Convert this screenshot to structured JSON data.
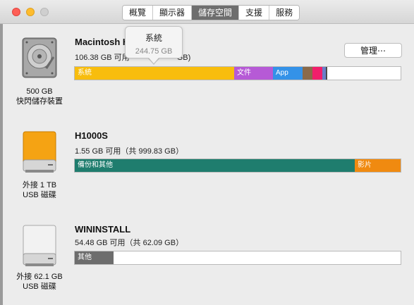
{
  "tabs": [
    "概覽",
    "顯示器",
    "儲存空間",
    "支援",
    "服務"
  ],
  "active_tab": 2,
  "drives": [
    {
      "name": "Macintosh H",
      "sub_prefix": "106.38 GB 可用",
      "sub_suffix": "GB)",
      "caption_line1": "500 GB",
      "caption_line2": "快閃儲存裝置",
      "icon": "hard-drive-icon",
      "segments": [
        {
          "label": "系統",
          "color": "#f8bd0d",
          "fraction": 0.49
        },
        {
          "label": "文件",
          "color": "#b65ad6",
          "fraction": 0.12
        },
        {
          "label": "App",
          "color": "#3492e8",
          "fraction": 0.09
        },
        {
          "label": "",
          "color": "#8a6a4a",
          "fraction": 0.03
        },
        {
          "label": "",
          "color": "#f21e6b",
          "fraction": 0.03
        },
        {
          "label": "",
          "color": "#6a7ec8",
          "fraction": 0.01
        },
        {
          "label": "",
          "color": "#4a4a4a",
          "fraction": 0.004
        }
      ],
      "manage_label": "管理⋯",
      "tooltip_title": "系統",
      "tooltip_value": "244.75 GB"
    },
    {
      "name": "H1000S",
      "sub": "1.55 GB 可用（共 999.83 GB）",
      "caption_line1": "外接 1 TB",
      "caption_line2": "USB 磁碟",
      "icon": "external-drive-orange-icon",
      "segments": [
        {
          "label": "備份和其他",
          "color": "#1f7d6e",
          "fraction": 0.86
        },
        {
          "label": "影片",
          "color": "#f08a10",
          "fraction": 0.14
        }
      ]
    },
    {
      "name": "WININSTALL",
      "sub": "54.48 GB 可用（共 62.09 GB）",
      "caption_line1": "外接 62.1 GB",
      "caption_line2": "USB 磁碟",
      "icon": "external-drive-white-icon",
      "segments": [
        {
          "label": "其他",
          "color": "#6d6d6d",
          "fraction": 0.12
        }
      ]
    }
  ]
}
